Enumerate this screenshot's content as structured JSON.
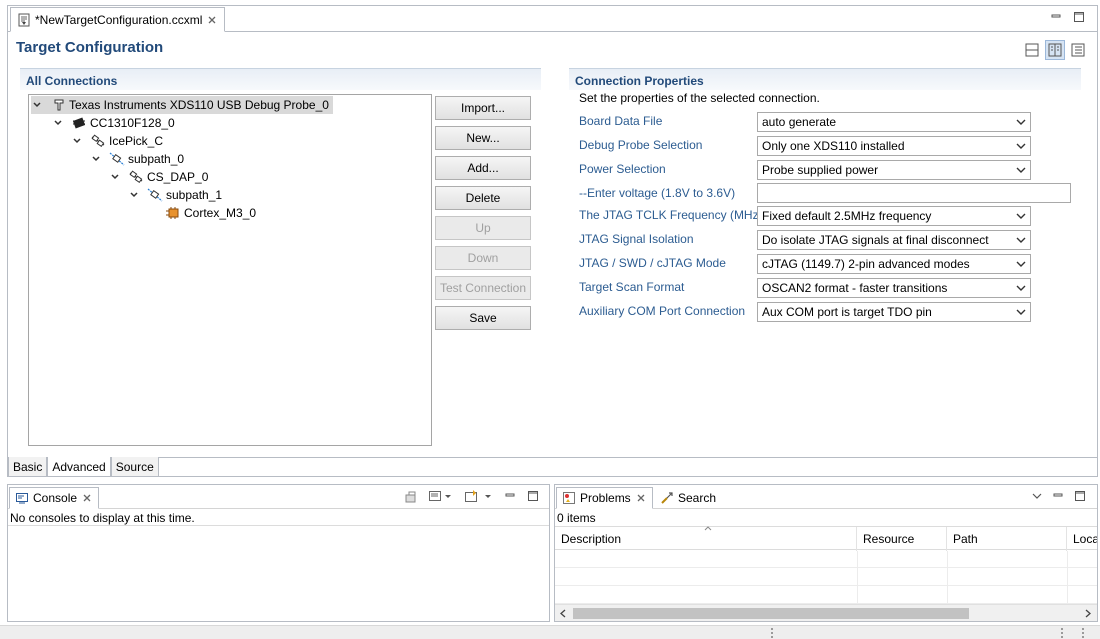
{
  "editor": {
    "tab_title": "*NewTargetConfiguration.ccxml",
    "form_title": "Target Configuration",
    "bottom_tabs": [
      "Basic",
      "Advanced",
      "Source"
    ],
    "active_bottom_tab": "Advanced"
  },
  "connections": {
    "heading": "All Connections",
    "tree": [
      {
        "label": "Texas Instruments XDS110 USB Debug Probe_0",
        "level": 0,
        "icon": "debug-probe-icon",
        "selected": true
      },
      {
        "label": "CC1310F128_0",
        "level": 1,
        "icon": "chip-icon"
      },
      {
        "label": "IcePick_C",
        "level": 2,
        "icon": "router-icon"
      },
      {
        "label": "subpath_0",
        "level": 3,
        "icon": "subpath-icon"
      },
      {
        "label": "CS_DAP_0",
        "level": 4,
        "icon": "router-icon"
      },
      {
        "label": "subpath_1",
        "level": 5,
        "icon": "subpath-icon"
      },
      {
        "label": "Cortex_M3_0",
        "level": 6,
        "icon": "cpu-core-icon"
      }
    ],
    "buttons": [
      {
        "label": "Import...",
        "enabled": true
      },
      {
        "label": "New...",
        "enabled": true
      },
      {
        "label": "Add...",
        "enabled": true
      },
      {
        "label": "Delete",
        "enabled": true
      },
      {
        "label": "Up",
        "enabled": false
      },
      {
        "label": "Down",
        "enabled": false
      },
      {
        "label": "Test Connection",
        "enabled": false
      },
      {
        "label": "Save",
        "enabled": true
      }
    ]
  },
  "properties": {
    "heading": "Connection Properties",
    "description": "Set the properties of the selected connection.",
    "rows": [
      {
        "label": "Board Data File",
        "value": "auto generate",
        "kind": "combo"
      },
      {
        "label": "Debug Probe Selection",
        "value": "Only one XDS110 installed",
        "kind": "combo"
      },
      {
        "label": "Power Selection",
        "value": "Probe supplied power",
        "kind": "combo"
      },
      {
        "label": "--Enter voltage (1.8V to 3.6V)",
        "value": "",
        "kind": "text"
      },
      {
        "label": "The JTAG TCLK Frequency (MHz)",
        "value": "Fixed default 2.5MHz frequency",
        "kind": "combo"
      },
      {
        "label": "JTAG Signal Isolation",
        "value": "Do isolate JTAG signals at final disconnect",
        "kind": "combo"
      },
      {
        "label": "JTAG / SWD / cJTAG Mode",
        "value": "cJTAG (1149.7) 2-pin advanced modes",
        "kind": "combo"
      },
      {
        "label": "Target Scan Format",
        "value": "OSCAN2 format - faster transitions",
        "kind": "combo"
      },
      {
        "label": "Auxiliary COM Port Connection",
        "value": "Aux COM port is target TDO pin",
        "kind": "combo"
      }
    ]
  },
  "console": {
    "tab": "Console",
    "message": "No consoles to display at this time."
  },
  "problems": {
    "tab": "Problems",
    "search_tab": "Search",
    "count": "0 items",
    "columns": [
      "Description",
      "Resource",
      "Path",
      "Loca"
    ]
  }
}
